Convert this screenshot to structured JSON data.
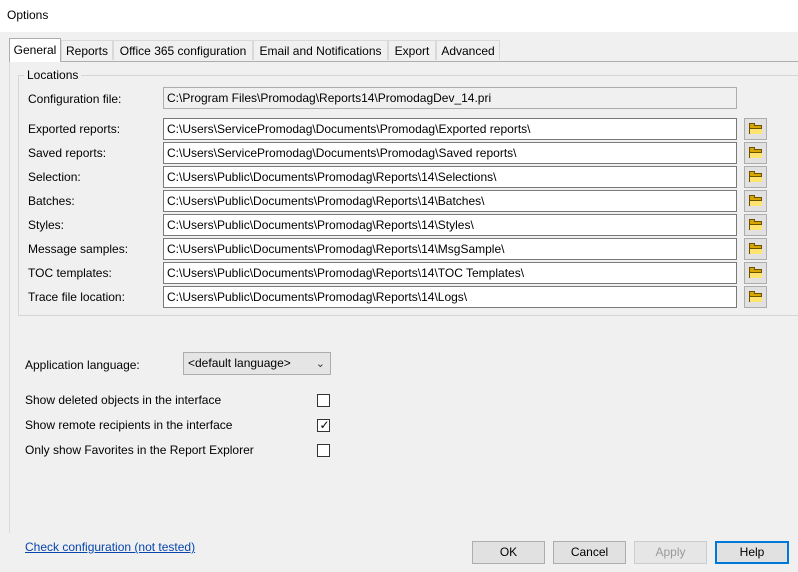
{
  "window": {
    "title": "Options"
  },
  "tabs": [
    {
      "label": "General"
    },
    {
      "label": "Reports"
    },
    {
      "label": "Office 365 configuration"
    },
    {
      "label": "Email and Notifications"
    },
    {
      "label": "Export"
    },
    {
      "label": "Advanced"
    }
  ],
  "locations": {
    "title": "Locations",
    "config_label": "Configuration file:",
    "config_value": "C:\\Program Files\\Promodag\\Reports14\\PromodagDev_14.pri",
    "paths": [
      {
        "label": "Exported reports:",
        "value": "C:\\Users\\ServicePromodag\\Documents\\Promodag\\Exported reports\\"
      },
      {
        "label": "Saved reports:",
        "value": "C:\\Users\\ServicePromodag\\Documents\\Promodag\\Saved reports\\"
      },
      {
        "label": "Selection:",
        "value": "C:\\Users\\Public\\Documents\\Promodag\\Reports\\14\\Selections\\"
      },
      {
        "label": "Batches:",
        "value": "C:\\Users\\Public\\Documents\\Promodag\\Reports\\14\\Batches\\"
      },
      {
        "label": "Styles:",
        "value": "C:\\Users\\Public\\Documents\\Promodag\\Reports\\14\\Styles\\"
      },
      {
        "label": "Message samples:",
        "value": "C:\\Users\\Public\\Documents\\Promodag\\Reports\\14\\MsgSample\\"
      },
      {
        "label": "TOC templates:",
        "value": "C:\\Users\\Public\\Documents\\Promodag\\Reports\\14\\TOC Templates\\"
      },
      {
        "label": "Trace file location:",
        "value": "C:\\Users\\Public\\Documents\\Promodag\\Reports\\14\\Logs\\"
      }
    ],
    "browse_icon": "folder-icon"
  },
  "language": {
    "label": "Application language:",
    "selected": "<default language>"
  },
  "options": [
    {
      "label": "Show deleted objects in the interface",
      "checked": false
    },
    {
      "label": "Show remote recipients in the interface",
      "checked": true
    },
    {
      "label": "Only show Favorites in the Report Explorer",
      "checked": false
    }
  ],
  "footer": {
    "check_link": "Check configuration (not tested)",
    "ok": "OK",
    "cancel": "Cancel",
    "apply": "Apply",
    "help": "Help"
  }
}
